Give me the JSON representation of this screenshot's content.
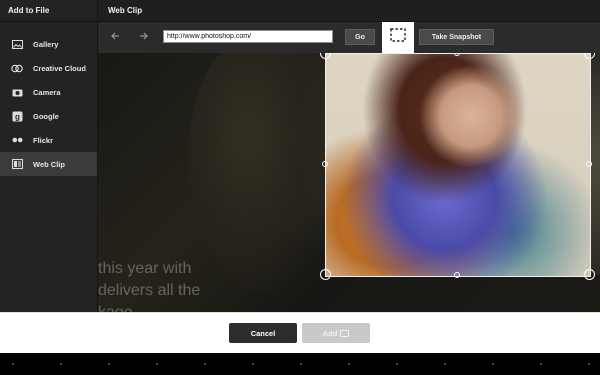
{
  "sidebar": {
    "title": "Add to File",
    "items": [
      {
        "label": "Gallery",
        "icon": "gallery-icon",
        "selected": false
      },
      {
        "label": "Creative Cloud",
        "icon": "creative-cloud-icon",
        "selected": false
      },
      {
        "label": "Camera",
        "icon": "camera-icon",
        "selected": false
      },
      {
        "label": "Google",
        "icon": "google-icon",
        "selected": false
      },
      {
        "label": "Flickr",
        "icon": "flickr-icon",
        "selected": false
      },
      {
        "label": "Web Clip",
        "icon": "web-clip-icon",
        "selected": true
      }
    ]
  },
  "main": {
    "title": "Web Clip",
    "toolbar": {
      "back_icon": "arrow-left-icon",
      "forward_icon": "arrow-right-icon",
      "url_value": "http://www.photoshop.com/",
      "go_label": "Go",
      "crop_tool_icon": "crop-selection-icon",
      "snapshot_label": "Take Snapshot"
    },
    "page_text": [
      "this year with",
      "delivers all the",
      "kage"
    ]
  },
  "footer": {
    "cancel_label": "Cancel",
    "add_label": "Add",
    "add_icon": "camera-icon"
  },
  "colors": {
    "sidebar_bg": "#232323",
    "selected_bg": "#3b3b3b",
    "button_dark": "#2d2d2d",
    "button_disabled": "#c9c9c9"
  }
}
